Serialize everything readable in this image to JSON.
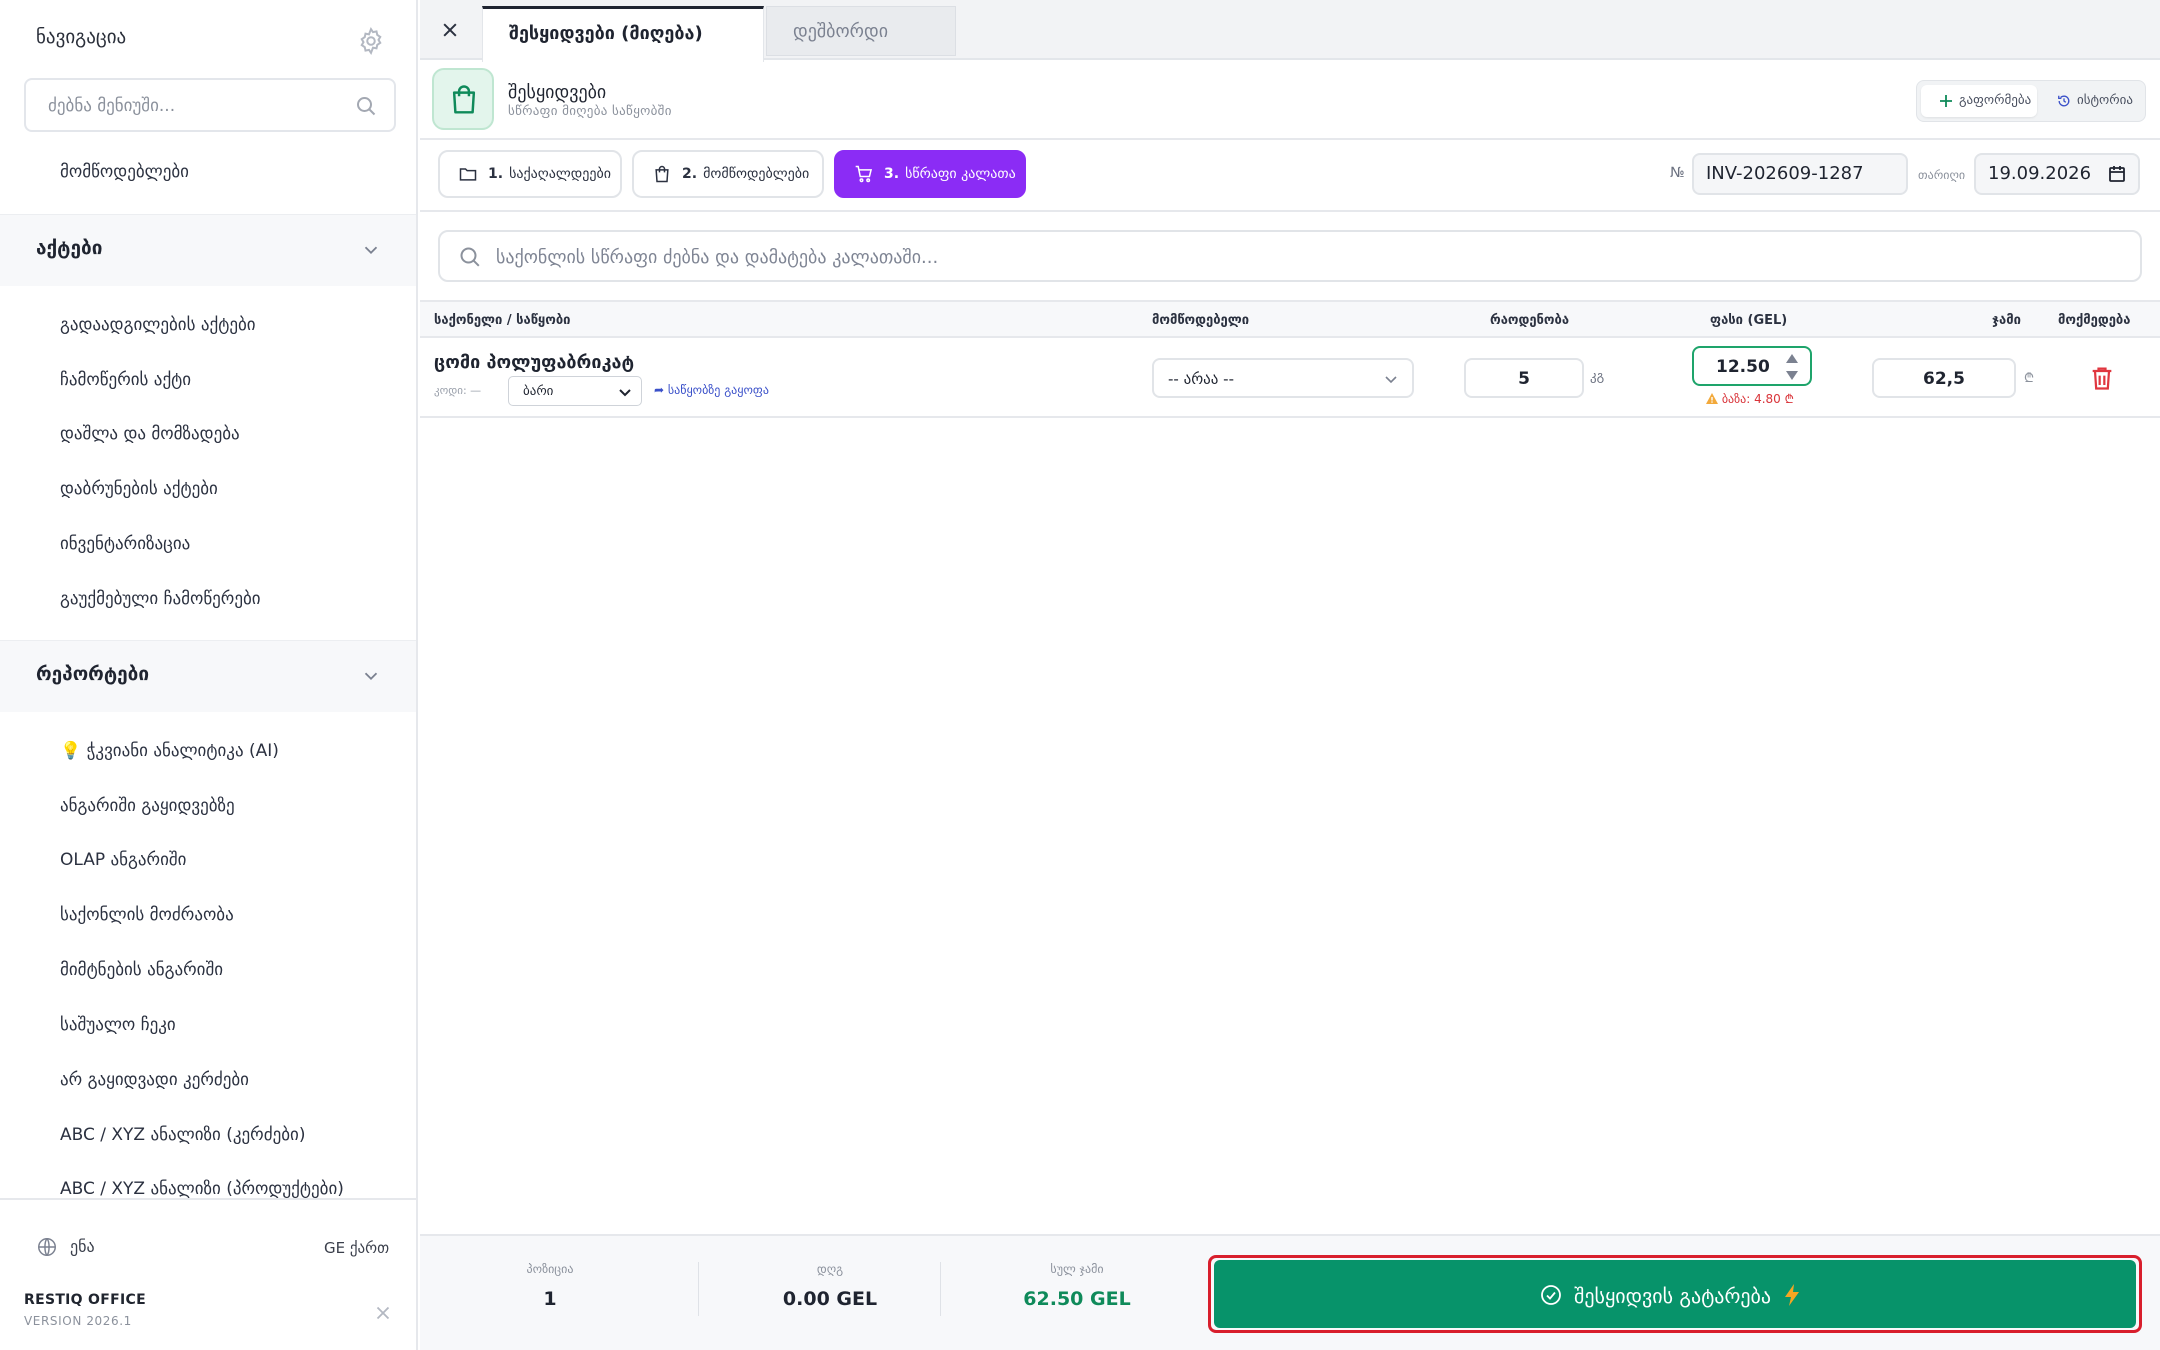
{
  "sidebar": {
    "title": "ნავიგაცია",
    "search_placeholder": "ძებნა მენიუში...",
    "top_item": "მომწოდებლები",
    "sections": [
      {
        "title": "აქტები",
        "items": [
          "გადაადგილების აქტები",
          "ჩამოწერის აქტი",
          "დაშლა და მომზადება",
          "დაბრუნების აქტები",
          "ინვენტარიზაცია",
          "გაუქმებული ჩამოწერები"
        ]
      },
      {
        "title": "რეპორტები",
        "items": [
          "💡 ჭკვიანი ანალიტიკა (AI)",
          "ანგარიში გაყიდვებზე",
          "OLAP ანგარიში",
          "საქონლის მოძრაობა",
          "მიმტნების ანგარიში",
          "საშუალო ჩეკი",
          "არ გაყიდვადი კერძები",
          "ABC / XYZ ანალიზი (კერძები)",
          "ABC / XYZ ანალიზი (პროდუქტები)"
        ]
      }
    ],
    "language_label": "ენა",
    "language_value": "GE ქართ",
    "brand": "RESTIQ OFFICE",
    "version": "VERSION 2026.1"
  },
  "tabs": [
    {
      "label": "შესყიდვები (მიღება)",
      "active": true
    },
    {
      "label": "დეშბორდი",
      "active": false
    }
  ],
  "header": {
    "title": "შესყიდვები",
    "subtitle": "სწრაფი მიღება საწყობში",
    "add_label": "გაფორმება",
    "history_label": "ისტორია"
  },
  "steps": [
    {
      "num": "1.",
      "label": "საქაღალდეები",
      "icon": "folder-icon"
    },
    {
      "num": "2.",
      "label": "მომწოდებლები",
      "icon": "bag-icon"
    },
    {
      "num": "3.",
      "label": "სწრაფი კალათა",
      "icon": "cart-icon"
    }
  ],
  "invoice": {
    "no_label": "№",
    "number": "INV-202609-1287",
    "date_label": "თარიღი",
    "date": "19.09.2026"
  },
  "product_search_placeholder": "საქონლის სწრაფი ძებნა და დამატება კალათაში...",
  "table": {
    "columns": [
      "საქონელი / საწყობი",
      "მომწოდებელი",
      "რაოდენობა",
      "ფასი (GEL)",
      "ჯამი",
      "მოქმედება"
    ],
    "rows": [
      {
        "product": "ცომი პოლუფაბრიკატ",
        "code_label": "კოდი: —",
        "warehouse": "ბარი",
        "warehouse_link": "➦ საწყობზე გაყოფა",
        "supplier": "-- არაა --",
        "quantity": "5",
        "unit": "კგ",
        "price": "12.50",
        "price_warning": "ბაზა: 4.80 ₾",
        "total": "62,5",
        "currency": "₾"
      }
    ]
  },
  "summary": {
    "positions_label": "პოზიცია",
    "positions_value": "1",
    "vat_label": "დღგ",
    "vat_value": "0.00 GEL",
    "total_label": "სულ ჯამი",
    "total_value": "62.50 GEL"
  },
  "cta_label": "შესყიდვის გატარება",
  "colors": {
    "accent_purple": "#8b2cf5",
    "primary_green": "#07936a",
    "highlight_red": "#d81e2c",
    "warning_red": "#d9343a"
  }
}
